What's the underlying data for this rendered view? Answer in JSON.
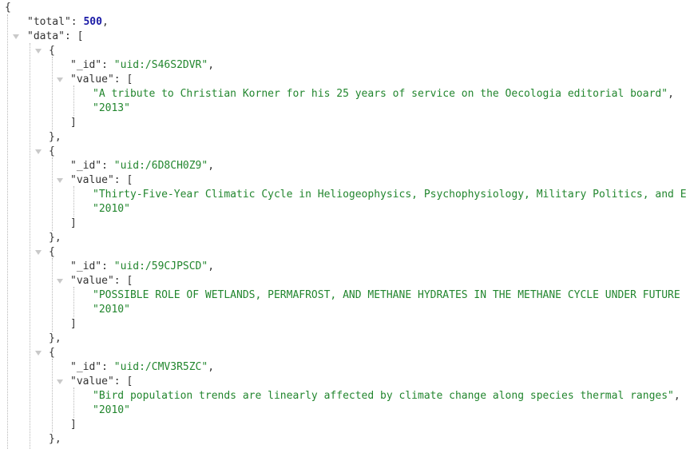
{
  "brackets": {
    "open_brace": "{",
    "close_brace": "}",
    "close_brace_comma": "},",
    "open_bracket": "[",
    "close_bracket": "]",
    "colon": ": ",
    "comma": ","
  },
  "root": {
    "total_key": "\"total\"",
    "total_value": "500",
    "data_key": "\"data\""
  },
  "items": [
    {
      "id_key": "\"_id\"",
      "id_value": "\"uid:/S46S2DVR\"",
      "value_key": "\"value\"",
      "title": "\"A tribute to Christian Korner for his 25 years of service on the Oecologia editorial board\"",
      "year": "\"2013\""
    },
    {
      "id_key": "\"_id\"",
      "id_value": "\"uid:/6D8CH0Z9\"",
      "value_key": "\"value\"",
      "title": "\"Thirty-Five-Year Climatic Cycle in Heliogeophysics, Psychophysiology, Military Politics, and E",
      "year": "\"2010\""
    },
    {
      "id_key": "\"_id\"",
      "id_value": "\"uid:/59CJPSCD\"",
      "value_key": "\"value\"",
      "title": "\"POSSIBLE ROLE OF WETLANDS, PERMAFROST, AND METHANE HYDRATES IN THE METHANE CYCLE UNDER FUTURE C",
      "year": "\"2010\""
    },
    {
      "id_key": "\"_id\"",
      "id_value": "\"uid:/CMV3R5ZC\"",
      "value_key": "\"value\"",
      "title": "\"Bird population trends are linearly affected by climate change along species thermal ranges\"",
      "year": "\"2010\""
    }
  ]
}
